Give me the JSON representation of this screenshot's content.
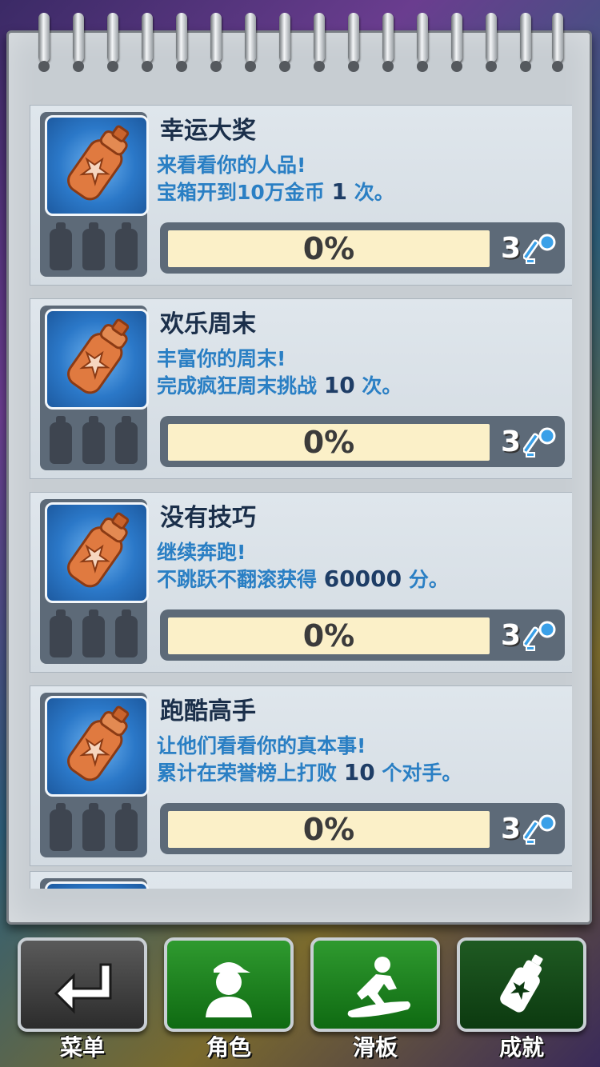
{
  "achievements": [
    {
      "title": "幸运大奖",
      "line1": "来看看你的人品!",
      "line2_pre": "宝箱开到10万金币 ",
      "line2_num": "1",
      "line2_post": " 次。",
      "progress_percent": 0,
      "progress_text": "0%",
      "reward_keys": "3",
      "bottles_filled": 0
    },
    {
      "title": "欢乐周末",
      "line1": "丰富你的周末!",
      "line2_pre": "完成疯狂周末挑战 ",
      "line2_num": "10",
      "line2_post": " 次。",
      "progress_percent": 0,
      "progress_text": "0%",
      "reward_keys": "3",
      "bottles_filled": 0
    },
    {
      "title": "没有技巧",
      "line1": "继续奔跑!",
      "line2_pre": "不跳跃不翻滚获得 ",
      "line2_num": "60000",
      "line2_post": " 分。",
      "progress_percent": 0,
      "progress_text": "0%",
      "reward_keys": "3",
      "bottles_filled": 0
    },
    {
      "title": "跑酷高手",
      "line1": "让他们看看你的真本事!",
      "line2_pre": "累计在荣誉榜上打败 ",
      "line2_num": "10",
      "line2_post": " 个对手。",
      "progress_percent": 0,
      "progress_text": "0%",
      "reward_keys": "3",
      "bottles_filled": 0
    }
  ],
  "tabs": [
    {
      "label": "菜单",
      "icon": "return-arrow-icon"
    },
    {
      "label": "角色",
      "icon": "character-icon"
    },
    {
      "label": "滑板",
      "icon": "skateboard-icon"
    },
    {
      "label": "成就",
      "icon": "spray-can-icon"
    }
  ],
  "colors": {
    "badge_bg": "#2b78c8",
    "can": "#e07a40",
    "progress_track": "#fbf0c8",
    "title": "#1b2f4a",
    "desc": "#2a7fc4"
  }
}
